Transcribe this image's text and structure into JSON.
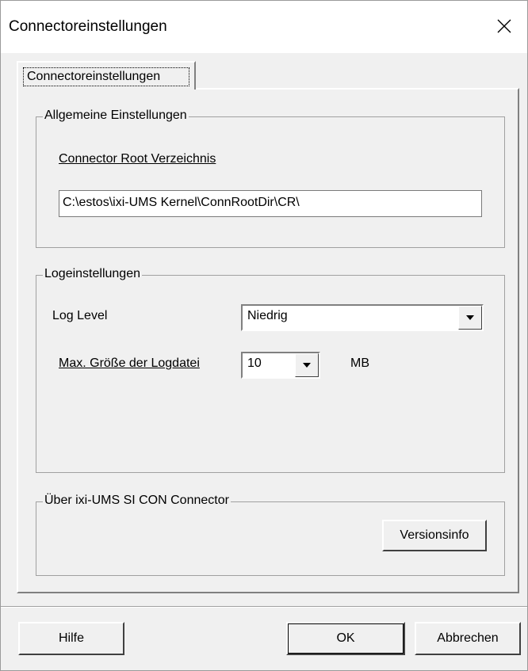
{
  "window": {
    "title": "Connectoreinstellungen"
  },
  "tabs": [
    {
      "label": "Connectoreinstellungen"
    }
  ],
  "general": {
    "legend": "Allgemeine Einstellungen",
    "root_dir_label": "Connector Root Verzeichnis",
    "root_dir_value": "C:\\estos\\ixi-UMS Kernel\\ConnRootDir\\CR\\"
  },
  "log": {
    "legend": "Logeinstellungen",
    "level_label": "Log Level",
    "level_value": "Niedrig",
    "maxsize_label": "Max. Größe der Logdatei",
    "maxsize_value": "10",
    "maxsize_unit": "MB"
  },
  "about": {
    "legend": "Über ixi-UMS SI CON Connector",
    "version_button": "Versionsinfo"
  },
  "footer": {
    "help_button": "Hilfe",
    "ok_button": "OK",
    "cancel_button": "Abbrechen"
  },
  "icons": {
    "close": "close-icon",
    "dropdown": "chevron-down-icon"
  }
}
